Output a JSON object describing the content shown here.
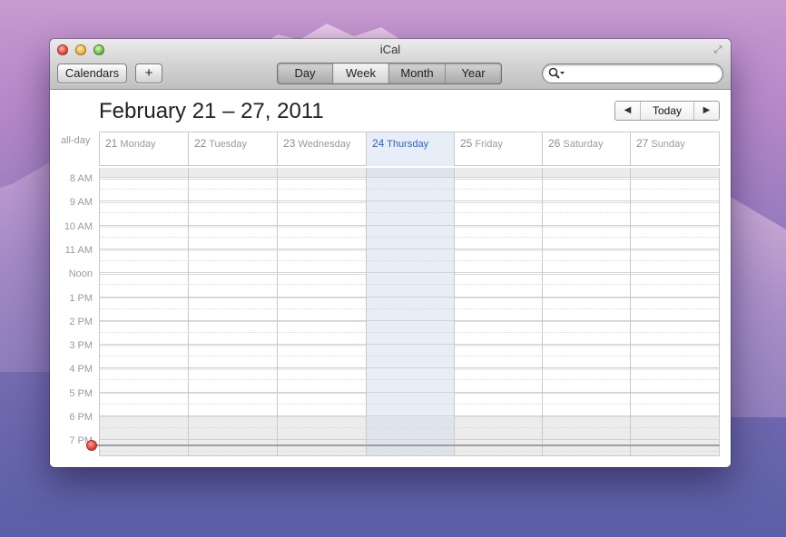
{
  "window": {
    "title": "iCal"
  },
  "toolbar": {
    "calendars_label": "Calendars",
    "add_label": "+",
    "segments": [
      "Day",
      "Week",
      "Month",
      "Year"
    ],
    "selected_segment": "Week",
    "search_placeholder": ""
  },
  "header": {
    "date_range": "February 21 – 27, 2011",
    "nav_prev": "◀",
    "nav_today": "Today",
    "nav_next": "▶"
  },
  "allday_label": "all-day",
  "days": [
    {
      "num": "21",
      "name": "Monday"
    },
    {
      "num": "22",
      "name": "Tuesday"
    },
    {
      "num": "23",
      "name": "Wednesday"
    },
    {
      "num": "24",
      "name": "Thursday",
      "today": true
    },
    {
      "num": "25",
      "name": "Friday"
    },
    {
      "num": "26",
      "name": "Saturday"
    },
    {
      "num": "27",
      "name": "Sunday"
    }
  ],
  "hours": [
    "8 AM",
    "9 AM",
    "10 AM",
    "11 AM",
    "Noon",
    "1 PM",
    "2 PM",
    "3 PM",
    "4 PM",
    "5 PM",
    "6 PM",
    "7 PM"
  ],
  "colors": {
    "today_column": "#e7eef7",
    "today_text": "#2e64c4",
    "current_time_dot": "#e2423a"
  }
}
